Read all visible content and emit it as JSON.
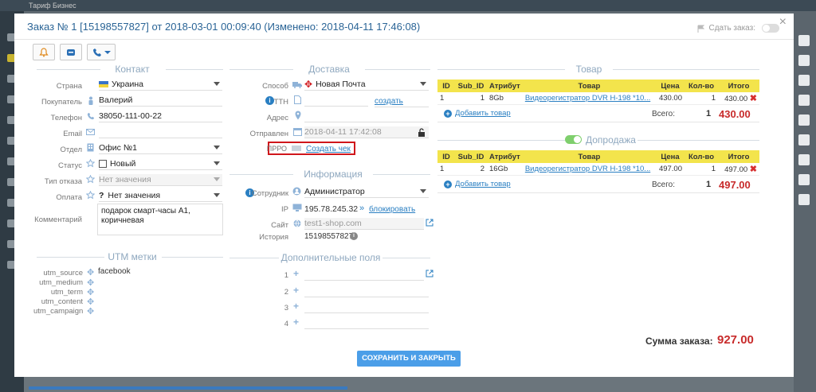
{
  "background": {
    "brand": "Тариф Бизнес"
  },
  "header": {
    "title": "Заказ № 1 [15198557827] от 2018-03-01 00:09:40 (Изменено: 2018-04-11 17:46:08)",
    "dispatch_label": "Сдать заказ:",
    "close_glyph": "×"
  },
  "sections": {
    "contact": "Контакт",
    "delivery": "Доставка",
    "info": "Информация",
    "utm": "UTM метки",
    "extra": "Дополнительные поля",
    "goods": "Товар",
    "upsell": "Допродажа"
  },
  "contact": {
    "country": {
      "label": "Страна",
      "value": "Украина"
    },
    "buyer": {
      "label": "Покупатель",
      "value": "Валерий"
    },
    "phone": {
      "label": "Телефон",
      "value": "38050-111-00-22"
    },
    "email": {
      "label": "Email",
      "value": ""
    },
    "department": {
      "label": "Отдел",
      "value": "Офис №1"
    },
    "status": {
      "label": "Статус",
      "value": "Новый"
    },
    "reject": {
      "label": "Тип отказа",
      "value": "Нет значения"
    },
    "payment": {
      "label": "Оплата",
      "value": "Нет значения"
    },
    "comment": {
      "label": "Комментарий",
      "value": "подарок смарт-часы А1, коричневая"
    }
  },
  "utm": {
    "source": {
      "label": "utm_source",
      "value": "facebook"
    },
    "medium": {
      "label": "utm_medium"
    },
    "term": {
      "label": "utm_term"
    },
    "content": {
      "label": "utm_content"
    },
    "campaign": {
      "label": "utm_campaign"
    }
  },
  "delivery": {
    "method": {
      "label": "Способ",
      "value": "Новая Почта"
    },
    "ttn": {
      "label": "ТТН",
      "action": "создать"
    },
    "address": {
      "label": "Адрес"
    },
    "sent": {
      "label": "Отправлен",
      "value": "2018-04-11 17:42:08"
    },
    "prro": {
      "label": "ПРРО",
      "action": "Создать чек"
    }
  },
  "info": {
    "employee": {
      "label": "Сотрудник",
      "value": "Администратор"
    },
    "ip": {
      "label": "IP",
      "value": "195.78.245.32",
      "action": "блокировать",
      "arrows": "»"
    },
    "site": {
      "label": "Сайт",
      "value": "test1-shop.com"
    },
    "history": {
      "label": "История",
      "value": "15198557827"
    }
  },
  "extra": {
    "rows": [
      "1",
      "2",
      "3",
      "4"
    ]
  },
  "goods": {
    "headers": [
      "ID",
      "Sub_ID",
      "Атрибут",
      "Товар",
      "Цена",
      "Кол-во",
      "Итого"
    ],
    "rows": [
      {
        "id": "1",
        "sub_id": "1",
        "attr": "8Gb",
        "name": "Видеорегистратор DVR H-198 *10...",
        "price": "430.00",
        "qty": "1",
        "total": "430.00"
      }
    ],
    "add_label": "Добавить товар",
    "total_label": "Всего:",
    "total_qty": "1",
    "total_sum": "430.00"
  },
  "upsell": {
    "headers": [
      "ID",
      "Sub_ID",
      "Атрибут",
      "Товар",
      "Цена",
      "Кол-во",
      "Итого"
    ],
    "rows": [
      {
        "id": "1",
        "sub_id": "2",
        "attr": "16Gb",
        "name": "Видеорегистратор DVR H-198 *10...",
        "price": "497.00",
        "qty": "1",
        "total": "497.00"
      }
    ],
    "add_label": "Добавить товар",
    "total_label": "Всего:",
    "total_qty": "1",
    "total_sum": "497.00"
  },
  "footer": {
    "order_sum_label": "Сумма заказа:",
    "order_sum_value": "927.00",
    "save_label": "СОХРАНИТЬ И ЗАКРЫТЬ"
  },
  "colors": {
    "accent": "#2a7fc2",
    "table_header": "#f3e44c",
    "price_red": "#c82b2b",
    "save_button": "#4b9ee8",
    "prro_highlight": "#d0161b"
  }
}
